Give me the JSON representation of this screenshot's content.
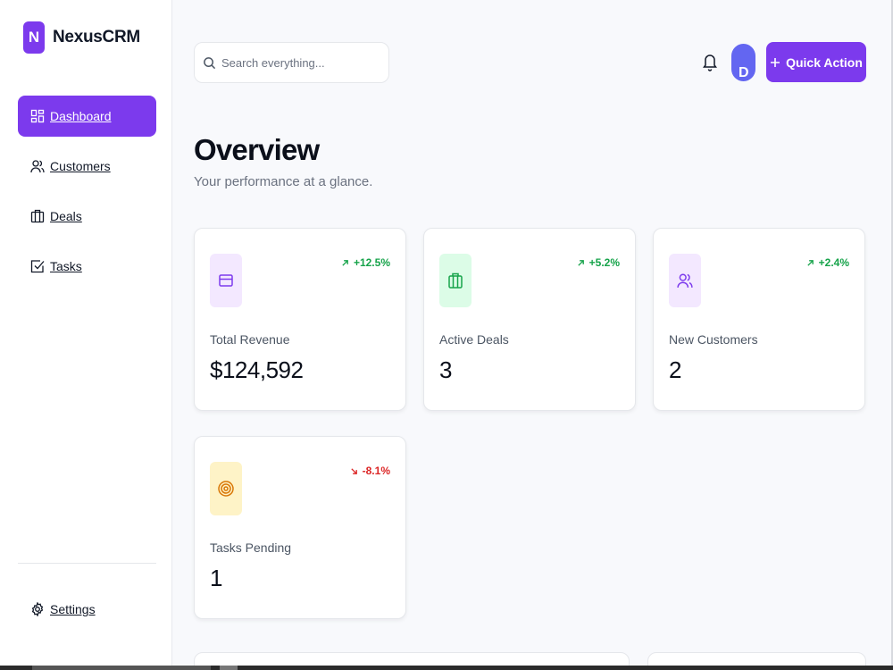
{
  "brand": {
    "logo_letter": "N",
    "name": "NexusCRM",
    "color": "#7c3aed"
  },
  "sidebar": {
    "items": [
      {
        "label": "Dashboard",
        "icon": "dashboard-icon",
        "active": true
      },
      {
        "label": "Customers",
        "icon": "users-icon",
        "active": false
      },
      {
        "label": "Deals",
        "icon": "briefcase-icon",
        "active": false
      },
      {
        "label": "Tasks",
        "icon": "checkbox-icon",
        "active": false
      }
    ],
    "settings_label": "Settings"
  },
  "header": {
    "search_placeholder": "Search everything...",
    "avatar_initial": "D",
    "quick_action_label": "Quick Action"
  },
  "page": {
    "title": "Overview",
    "subtitle": "Your performance at a glance."
  },
  "metrics": [
    {
      "label": "Total Revenue",
      "value": "$124,592",
      "change": "+12.5%",
      "trend": "up",
      "icon": "credit-card-icon",
      "icon_bg": "#f3e8ff",
      "icon_color": "#7c3aed"
    },
    {
      "label": "Active Deals",
      "value": "3",
      "change": "+5.2%",
      "trend": "up",
      "icon": "briefcase-icon",
      "icon_bg": "#dcfce7",
      "icon_color": "#16a34a"
    },
    {
      "label": "New Customers",
      "value": "2",
      "change": "+2.4%",
      "trend": "up",
      "icon": "users-icon",
      "icon_bg": "#f3e8ff",
      "icon_color": "#7c3aed"
    },
    {
      "label": "Tasks Pending",
      "value": "1",
      "change": "-8.1%",
      "trend": "down",
      "icon": "target-icon",
      "icon_bg": "#fef3c7",
      "icon_color": "#d97706"
    }
  ],
  "colors": {
    "accent": "#7c3aed",
    "positive": "#16a34a",
    "negative": "#dc2626"
  }
}
